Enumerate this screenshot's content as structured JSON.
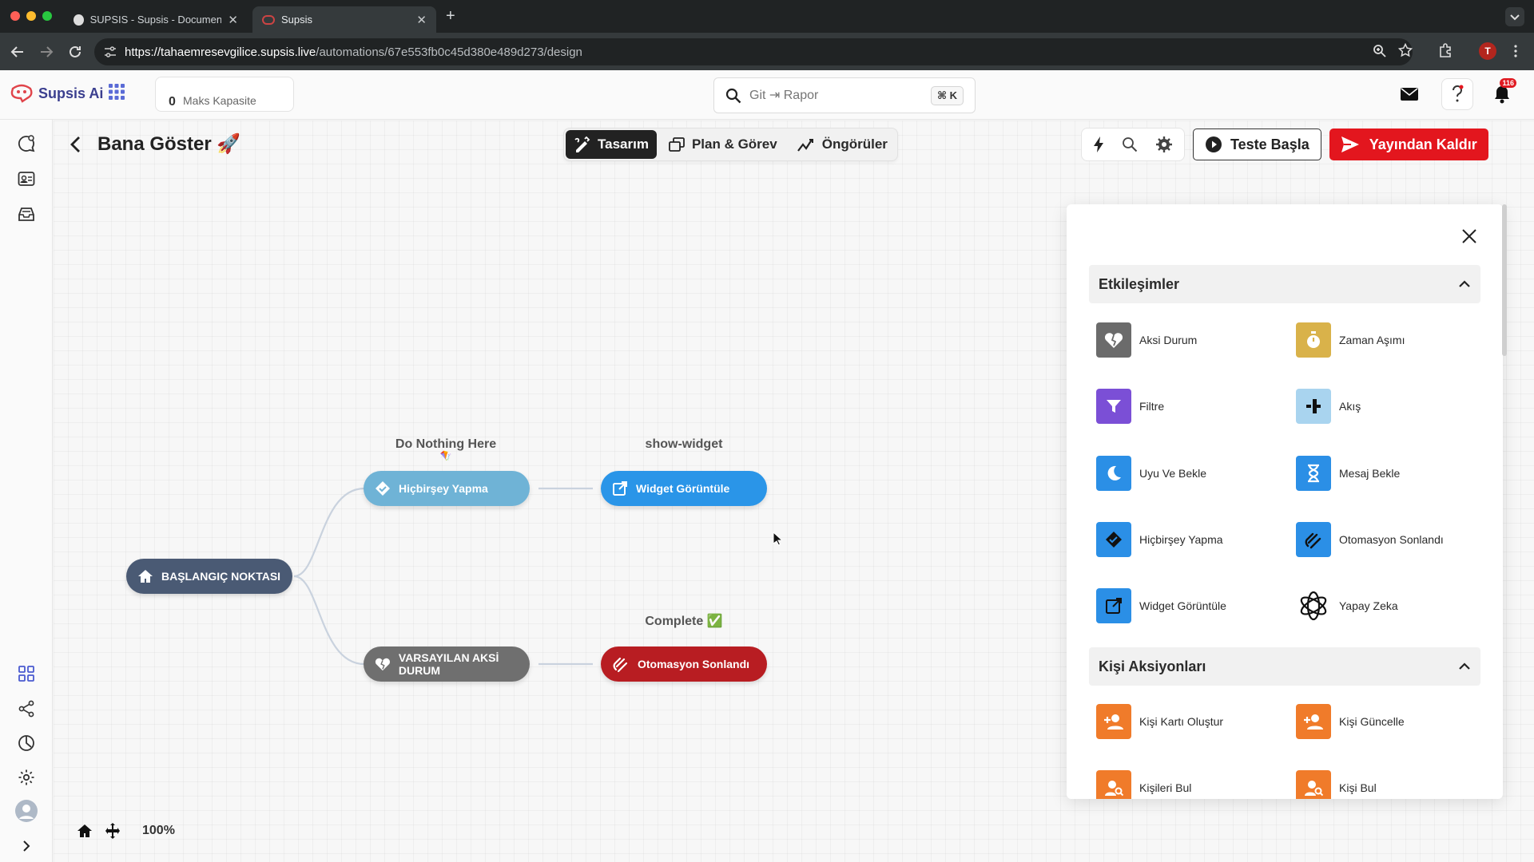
{
  "browser": {
    "tabs": [
      {
        "title": "SUPSIS - Supsis - Documentati",
        "active": false
      },
      {
        "title": "Supsis",
        "active": true
      }
    ],
    "url_host": "https://tahaemresevgilice.supsis.live",
    "url_path": "/automations/67e553fb0c45d380e489d273/design",
    "profile_initial": "T"
  },
  "header": {
    "logo_text": "Supsis Ai",
    "capacity_value": "0",
    "capacity_label": "Maks Kapasite",
    "search_placeholder": "Git ⇥ Rapor",
    "search_shortcut": "⌘ K",
    "notification_count": "116"
  },
  "page": {
    "title": "Bana Göster 🚀",
    "mode_tabs": [
      {
        "label": "Tasarım",
        "icon": "design-icon",
        "active": true
      },
      {
        "label": "Plan & Görev",
        "icon": "plan-icon",
        "active": false
      },
      {
        "label": "Öngörüler",
        "icon": "insights-icon",
        "active": false
      }
    ],
    "test_button": "Teste Başla",
    "unpublish_button": "Yayından Kaldır",
    "zoom": "100%"
  },
  "flow": {
    "start": {
      "label": "BAŞLANGIÇ NOKTASI",
      "color": "#4a5a74"
    },
    "nodes": [
      {
        "caption": "Do Nothing Here",
        "caption_emoji": "🪁",
        "label": "Hiçbirşey Yapma",
        "color": "#6fb3d6"
      },
      {
        "caption": "show-widget",
        "label": "Widget Görüntüle",
        "color": "#2a95e8"
      },
      {
        "label": "VARSAYILAN AKSİ DURUM",
        "color": "#6f6f6f"
      },
      {
        "caption": "Complete ✅",
        "label": "Otomasyon Sonlandı",
        "color": "#b81d22"
      }
    ]
  },
  "panel": {
    "sections": [
      {
        "title": "Etkileşimler",
        "items": [
          {
            "label": "Aksi Durum",
            "icon": "heart-break-icon",
            "color": "#6b6b6b"
          },
          {
            "label": "Zaman Aşımı",
            "icon": "stopwatch-icon",
            "color": "#d9b24a"
          },
          {
            "label": "Filtre",
            "icon": "funnel-icon",
            "color": "#7b4fd6"
          },
          {
            "label": "Akış",
            "icon": "flow-split-icon",
            "color": "#a9d4ef"
          },
          {
            "label": "Uyu Ve Bekle",
            "icon": "moon-icon",
            "color": "#2b8fe6"
          },
          {
            "label": "Mesaj Bekle",
            "icon": "hourglass-icon",
            "color": "#2b8fe6"
          },
          {
            "label": "Hiçbirşey Yapma",
            "icon": "diamond-handshake-icon",
            "color": "#2b8fe6"
          },
          {
            "label": "Otomasyon Sonlandı",
            "icon": "waving-hand-icon",
            "color": "#2b8fe6"
          },
          {
            "label": "Widget Görüntüle",
            "icon": "external-link-icon",
            "color": "#2b8fe6"
          },
          {
            "label": "Yapay Zeka",
            "icon": "openai-icon",
            "color": "#ffffff"
          }
        ]
      },
      {
        "title": "Kişi Aksiyonları",
        "items": [
          {
            "label": "Kişi Kartı Oluştur",
            "icon": "person-add-icon",
            "color": "#f07b2a"
          },
          {
            "label": "Kişi Güncelle",
            "icon": "person-edit-icon",
            "color": "#f07b2a"
          },
          {
            "label": "Kişileri Bul",
            "icon": "person-search-icon",
            "color": "#f07b2a"
          },
          {
            "label": "Kişi Bul",
            "icon": "person-find-icon",
            "color": "#f07b2a"
          }
        ]
      }
    ]
  }
}
